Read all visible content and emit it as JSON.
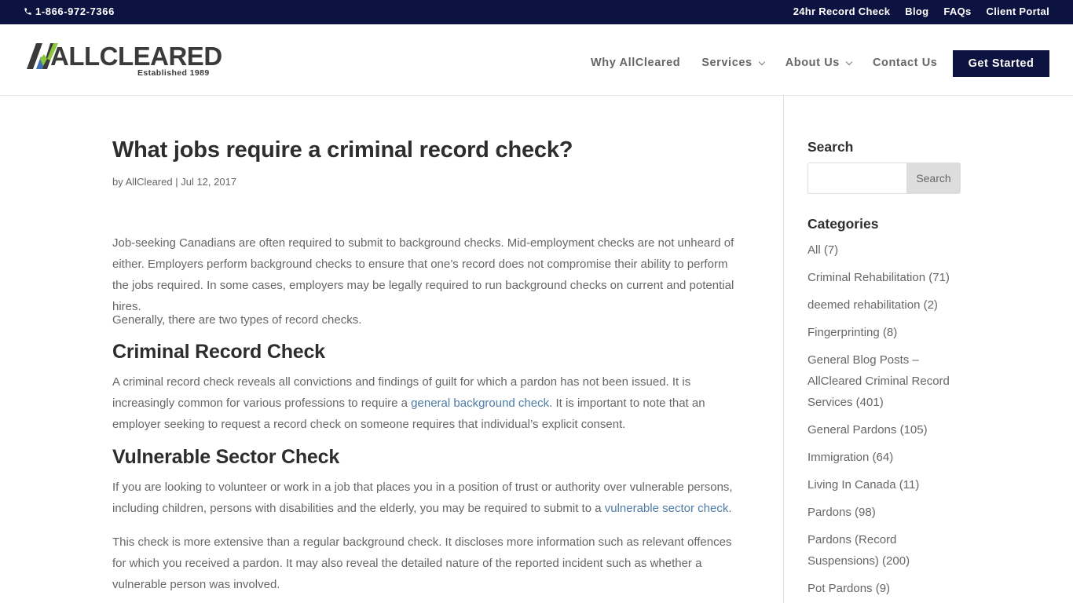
{
  "topbar": {
    "phone": "1-866-972-7366",
    "links": [
      "24hr Record Check",
      "Blog",
      "FAQs",
      "Client Portal"
    ]
  },
  "header": {
    "logo_text": "ALLCLEARED",
    "logo_tagline": "Established 1989",
    "nav": [
      {
        "label": "Why AllCleared",
        "has_dropdown": false
      },
      {
        "label": "Services",
        "has_dropdown": true
      },
      {
        "label": "About Us",
        "has_dropdown": true
      },
      {
        "label": "Contact Us",
        "has_dropdown": false
      }
    ],
    "cta_label": "Get Started"
  },
  "article": {
    "title": "What jobs require a criminal record check?",
    "meta": {
      "by": "by ",
      "author": "AllCleared",
      "separator": " | ",
      "date": "Jul 12, 2017"
    },
    "intro_p1": "Job-seeking Canadians are often required to submit to background checks. Mid-employment checks are not unheard of either. Employers perform background checks to ensure that one’s record does not compromise their ability to perform the jobs required. In some cases, employers may be legally required to run background checks on current and potential hires.",
    "intro_p2": "Generally, there are two types of record checks.",
    "section1": {
      "heading": "Criminal Record Check",
      "p_before": "A criminal record check reveals all convictions and findings of guilt for which a pardon has not been issued. It is increasingly common for various professions to require a ",
      "link": "general background check",
      "p_after": ". It is important to note that an employer seeking to request a record check on someone requires that individual’s explicit consent."
    },
    "section2": {
      "heading": "Vulnerable Sector Check",
      "p_before": "If you are looking to volunteer or work in a job that places you in a position of trust or authority over vulnerable persons, including children, persons with disabilities and the elderly, you may be required to submit to a ",
      "link": "vulnerable sector check",
      "p_after": ".",
      "p2": "This check is more extensive than a regular background check. It discloses more information such as relevant offences for which you received a pardon. It may also reveal the detailed nature of the reported incident such as whether a vulnerable person was involved."
    }
  },
  "sidebar": {
    "search_title": "Search",
    "search_value": "",
    "search_button": "Search",
    "categories_title": "Categories",
    "categories": [
      "All (7)",
      "Criminal Rehabilitation (71)",
      "deemed rehabilitation (2)",
      "Fingerprinting (8)",
      "General Blog Posts – AllCleared Criminal Record Services (401)",
      "General Pardons (105)",
      "Immigration (64)",
      "Living In Canada (11)",
      "Pardons (98)",
      "Pardons (Record Suspensions) (200)",
      "Pot Pardons (9)"
    ]
  },
  "colors": {
    "navy": "#0c1340",
    "link": "#4e7ba6",
    "logo_green": "#8cc63f",
    "logo_blue": "#3f6fb5"
  }
}
